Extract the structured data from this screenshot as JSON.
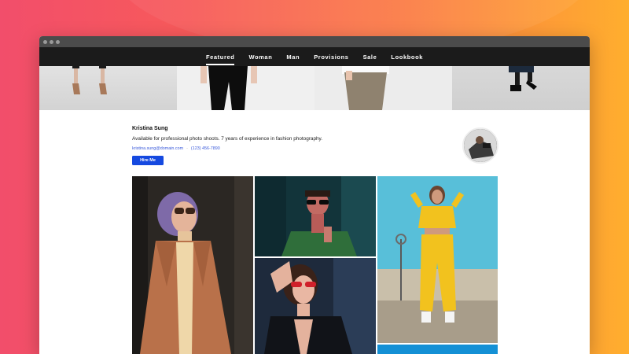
{
  "nav": {
    "items": [
      "Featured",
      "Woman",
      "Man",
      "Provisions",
      "Sale",
      "Lookbook"
    ]
  },
  "profile": {
    "name": "Kristina Sung",
    "bio": "Available for professional photo shoots. 7 years of experience in fashion photography.",
    "email": "kristina.sung@domain.com",
    "separator": "·",
    "phone": "(123) 456-7890",
    "hire_label": "Hire Me"
  },
  "colors": {
    "accent": "#1549e0",
    "nav_bg": "#1b1b1b",
    "link": "#3b5bdb"
  }
}
